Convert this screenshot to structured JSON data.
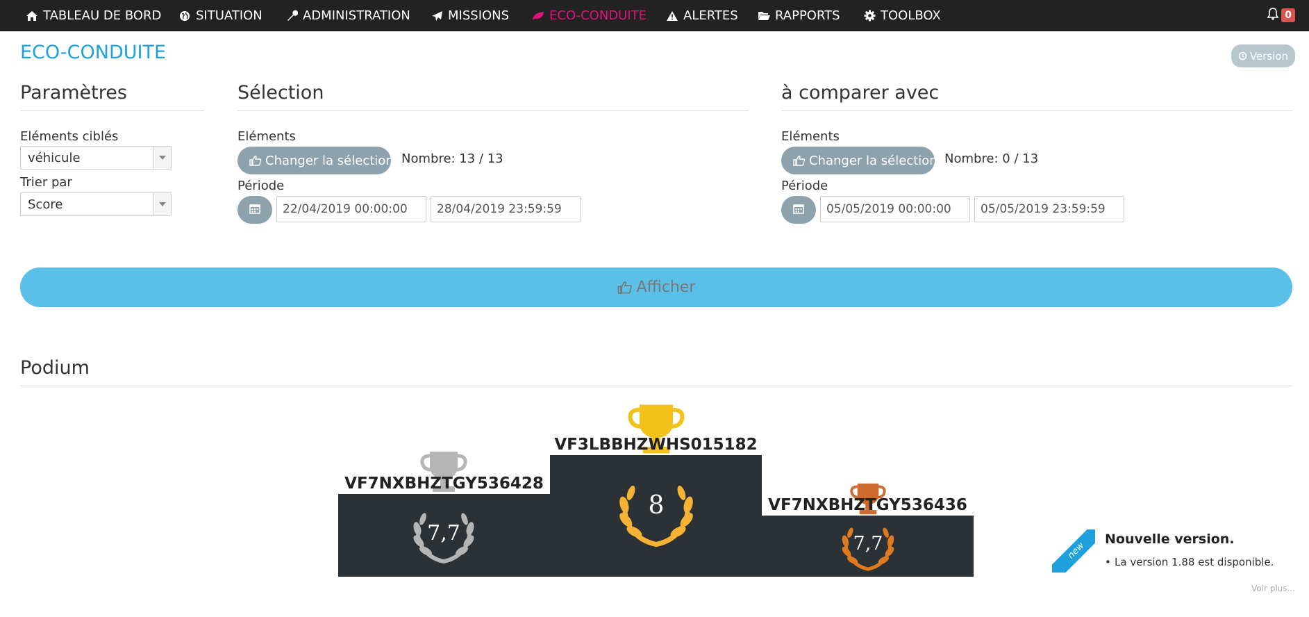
{
  "nav": {
    "items": [
      {
        "label": "TABLEAU DE BORD",
        "icon": "home-icon"
      },
      {
        "label": "SITUATION",
        "icon": "globe-icon"
      },
      {
        "label": "ADMINISTRATION",
        "icon": "wrench-icon"
      },
      {
        "label": "MISSIONS",
        "icon": "paper-plane-icon"
      },
      {
        "label": "ECO-CONDUITE",
        "icon": "leaf-icon"
      },
      {
        "label": "ALERTES",
        "icon": "warning-icon"
      },
      {
        "label": "RAPPORTS",
        "icon": "folder-open-icon"
      },
      {
        "label": "TOOLBOX",
        "icon": "gear-icon"
      }
    ],
    "active_color": "#e0137a",
    "bell_count": "0"
  },
  "page_title": "ECO-CONDUITE",
  "version_button": "Version",
  "parametres": {
    "title": "Paramètres",
    "elements_label": "Eléments ciblés",
    "elements_value": "véhicule",
    "sort_label": "Trier par",
    "sort_value": "Score"
  },
  "selection": {
    "title": "Sélection",
    "elements_label": "Eléments",
    "change_button": "Changer la sélection",
    "count": "Nombre: 13 / 13",
    "period_label": "Période",
    "date_from": "22/04/2019 00:00:00",
    "date_to": "28/04/2019 23:59:59"
  },
  "compare": {
    "title": "à comparer avec",
    "elements_label": "Eléments",
    "change_button": "Changer la sélection",
    "count": "Nombre: 0 / 13",
    "period_label": "Période",
    "date_from": "05/05/2019 00:00:00",
    "date_to": "05/05/2019 23:59:59"
  },
  "afficher_button": "Afficher",
  "podium": {
    "title": "Podium",
    "first": {
      "name": "VF3LBBHZWHS015182",
      "score": "8",
      "color": "#f2c21b"
    },
    "second": {
      "name": "VF7NXBHZTGY536428",
      "score": "7,7",
      "color": "#b5b5b5"
    },
    "third": {
      "name": "VF7NXBHZTGY536436",
      "score": "7,7",
      "color": "#cd6a2e"
    }
  },
  "notification": {
    "ribbon": "new",
    "title": "Nouvelle version.",
    "text": "La version 1.88 est disponible.",
    "more": "Voir plus..."
  }
}
